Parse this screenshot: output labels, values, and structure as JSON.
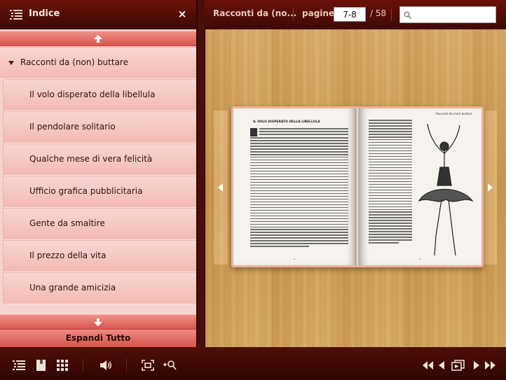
{
  "sidebar": {
    "title": "Indice",
    "close_label": "×",
    "expand_all_label": "Espandi Tutto",
    "items": [
      {
        "label": "Racconti da (non) buttare",
        "level": "parent"
      },
      {
        "label": "Il volo disperato della libellula",
        "level": "child"
      },
      {
        "label": "Il pendolare solitario",
        "level": "child"
      },
      {
        "label": "Qualche mese di vera felicità",
        "level": "child"
      },
      {
        "label": "Ufficio grafica pubblicitaria",
        "level": "child"
      },
      {
        "label": "Gente da smaltire",
        "level": "child"
      },
      {
        "label": "Il prezzo della vita",
        "level": "child"
      },
      {
        "label": "Una grande amicizia",
        "level": "child"
      }
    ]
  },
  "topbar": {
    "doc_title": "Racconti da (no...",
    "pages_label": "pagine:",
    "page_value": "7-8",
    "page_total": "/ 58",
    "search_placeholder": ""
  },
  "book": {
    "left_heading": "IL VOLO DISPERATO DELLA LIBELLULA",
    "right_heading": "Racconti da (non) buttare"
  },
  "colors": {
    "bar_dark": "#3e0804",
    "accent_salmon": "#d9574d",
    "list_pink": "#f7d3cf",
    "wood": "#c9964f"
  },
  "icons": {
    "toc": "list-icon",
    "single_page": "single-page-icon",
    "thumbnails": "grid-icon",
    "sound": "speaker-icon",
    "fullscreen": "fullscreen-icon",
    "zoom": "zoom-in-icon",
    "first": "first-page-icon",
    "prev": "prev-page-icon",
    "slideshow": "slideshow-icon",
    "next": "next-page-icon",
    "last": "last-page-icon"
  }
}
